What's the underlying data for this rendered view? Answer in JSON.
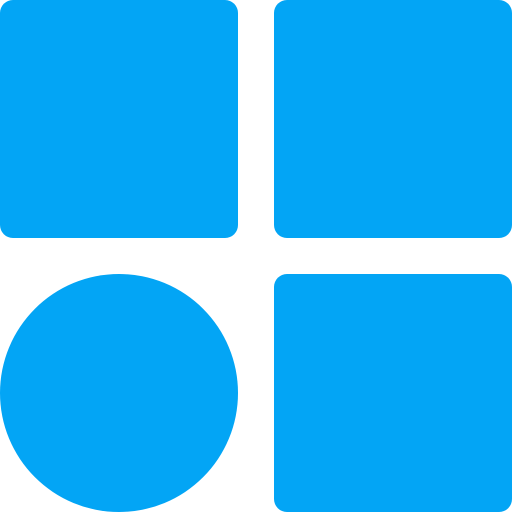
{
  "icon": {
    "name": "apps-grid-icon",
    "color": "#03A5F5",
    "background": "#FFFFFF",
    "tiles": [
      {
        "name": "square-tile-top-left",
        "shape": "rounded-square"
      },
      {
        "name": "square-tile-top-right",
        "shape": "rounded-square"
      },
      {
        "name": "circle-tile-bottom-left",
        "shape": "circle"
      },
      {
        "name": "square-tile-bottom-right",
        "shape": "rounded-square"
      }
    ]
  }
}
